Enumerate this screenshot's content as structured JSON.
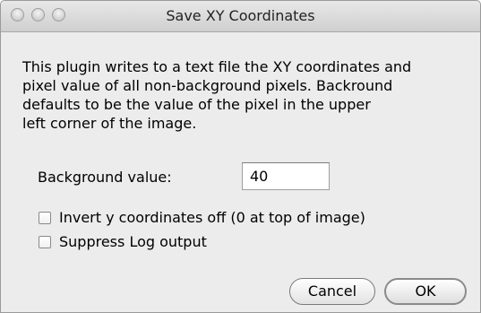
{
  "window": {
    "title": "Save XY Coordinates"
  },
  "description": "This plugin writes to a text file the XY coordinates and\npixel value of all non-background pixels. Backround\ndefaults to be the value of the pixel in the upper\nleft corner of the image.",
  "background": {
    "label": "Background value:",
    "value": "40"
  },
  "options": [
    {
      "label": "Invert y coordinates off (0 at top of image)",
      "checked": false
    },
    {
      "label": "Suppress Log output",
      "checked": false
    }
  ],
  "buttons": {
    "cancel": "Cancel",
    "ok": "OK"
  }
}
